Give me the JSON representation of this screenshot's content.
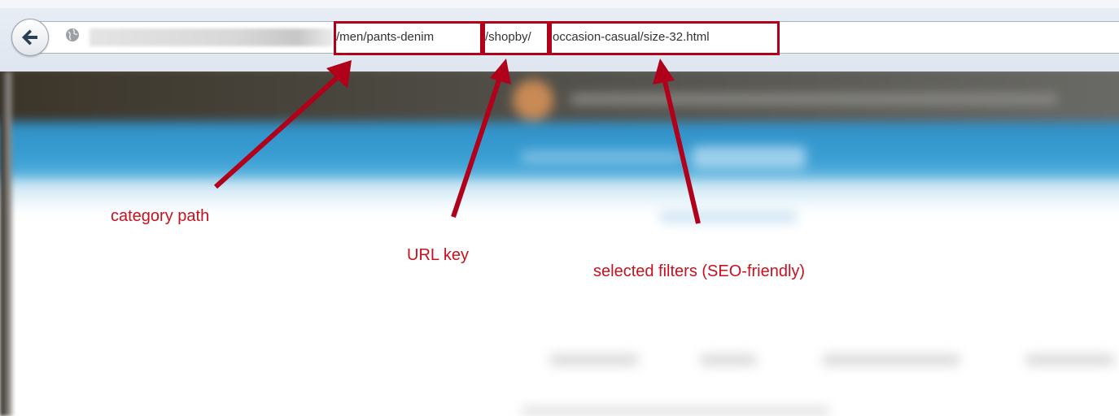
{
  "browser": {
    "url_parts": {
      "category_path": "/men/pants-denim",
      "url_key": "/shopby/",
      "filters": "occasion-casual/size-32.html"
    }
  },
  "annotations": [
    {
      "id": "category",
      "label": "category path"
    },
    {
      "id": "urlkey",
      "label": "URL key"
    },
    {
      "id": "filters",
      "label": "selected filters (SEO-friendly)"
    }
  ],
  "colors": {
    "highlight": "#b0001a",
    "annotation_text": "#c8101e",
    "header_blue": "#3ba0d4"
  },
  "icons": [
    "back-arrow-icon",
    "globe-icon"
  ]
}
